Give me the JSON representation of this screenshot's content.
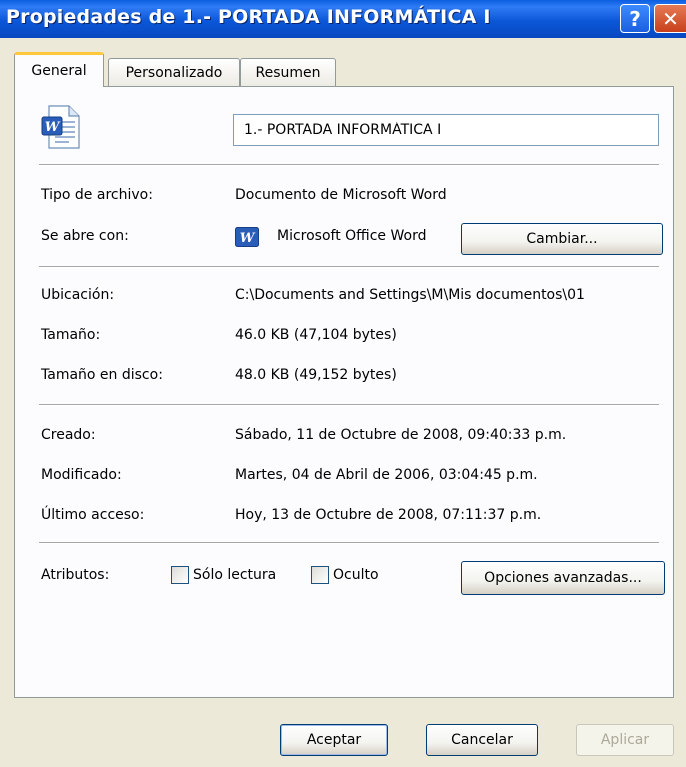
{
  "window": {
    "title": "Propiedades de 1.- PORTADA INFORMÁTICA I",
    "help_label": "?",
    "close_label": "✕"
  },
  "tabs": [
    {
      "label": "General",
      "active": true
    },
    {
      "label": "Personalizado",
      "active": false
    },
    {
      "label": "Resumen",
      "active": false
    }
  ],
  "general": {
    "file_name": "1.- PORTADA INFORMÁTICA I",
    "file_icon": "word-document-icon",
    "tipo_label": "Tipo de archivo:",
    "tipo_value": "Documento de Microsoft Word",
    "abre_label": "Se abre con:",
    "abre_icon": "word-app-icon",
    "abre_value": "Microsoft Office Word",
    "cambiar_label": "Cambiar...",
    "ubicacion_label": "Ubicación:",
    "ubicacion_value": "C:\\Documents and Settings\\M\\Mis documentos\\01",
    "tamano_label": "Tamaño:",
    "tamano_value": "46.0 KB (47,104 bytes)",
    "disco_label": "Tamaño en disco:",
    "disco_value": "48.0 KB (49,152 bytes)",
    "creado_label": "Creado:",
    "creado_value": "Sábado, 11 de Octubre de 2008, 09:40:33 p.m.",
    "modificado_label": "Modificado:",
    "modificado_value": "Martes, 04 de Abril de 2006, 03:04:45 p.m.",
    "acceso_label": "Último acceso:",
    "acceso_value": "Hoy, 13 de Octubre de 2008, 07:11:37 p.m.",
    "atributos_label": "Atributos:",
    "solo_lectura_label": "Sólo lectura",
    "solo_lectura_checked": false,
    "oculto_label": "Oculto",
    "oculto_checked": false,
    "opciones_label": "Opciones avanzadas..."
  },
  "footer": {
    "aceptar_label": "Aceptar",
    "cancelar_label": "Cancelar",
    "aplicar_label": "Aplicar"
  },
  "colors": {
    "titlebar": "#0B57D8",
    "dialog_bg": "#ECE9D8",
    "tab_highlight": "#FFC83C"
  }
}
